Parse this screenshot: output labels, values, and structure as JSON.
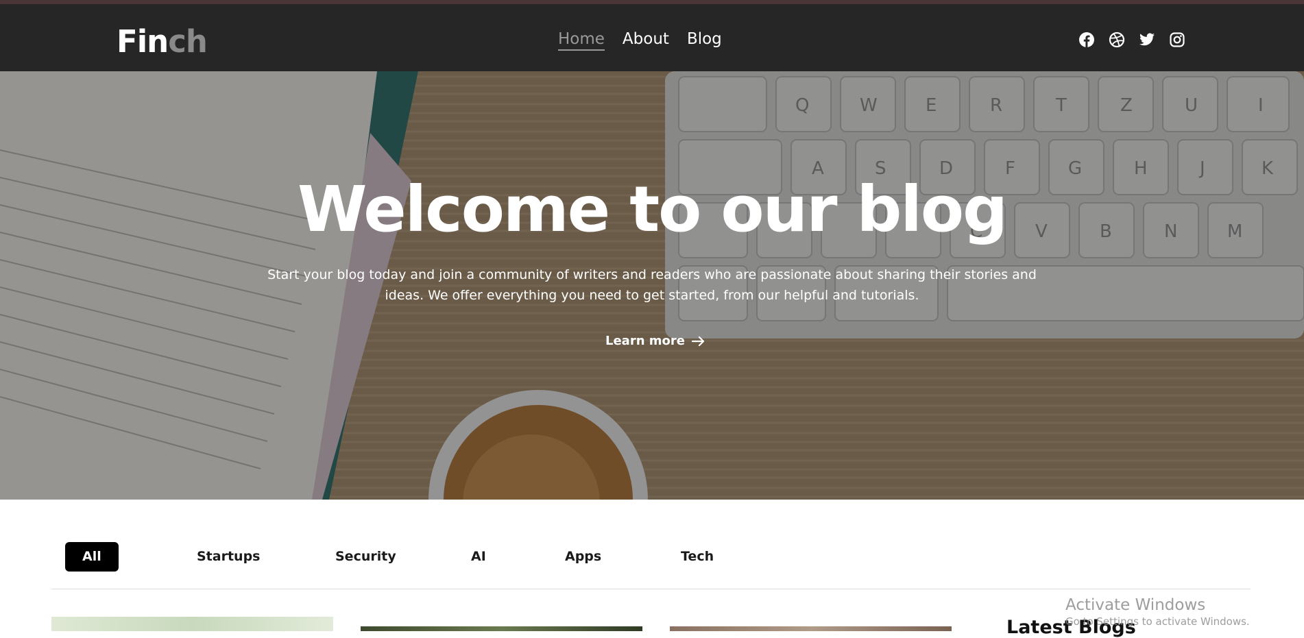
{
  "brand": {
    "part1": "Fin",
    "part2": "ch"
  },
  "nav": {
    "items": [
      {
        "label": "Home",
        "active": true
      },
      {
        "label": "About"
      },
      {
        "label": "Blog"
      }
    ]
  },
  "socials": [
    "facebook-icon",
    "dribbble-icon",
    "twitter-icon",
    "instagram-icon"
  ],
  "hero": {
    "title": "Welcome to our blog",
    "subtitle": "Start your blog today and join a community of writers and readers who are passionate about sharing their stories and ideas. We offer everything you need to get started, from our helpful and tutorials.",
    "cta": "Learn more"
  },
  "categories": [
    "All",
    "Startups",
    "Security",
    "AI",
    "Apps",
    "Tech"
  ],
  "active_category": "All",
  "sidebar": {
    "latest_heading": "Latest Blogs"
  },
  "watermark": {
    "line1": "Activate Windows",
    "line2": "Go to Settings to activate Windows."
  },
  "colors": {
    "nav_bg": "#262626",
    "top_strip": "#4a3538",
    "accent_active": "#000000",
    "muted_nav": "#9a9a9a"
  }
}
